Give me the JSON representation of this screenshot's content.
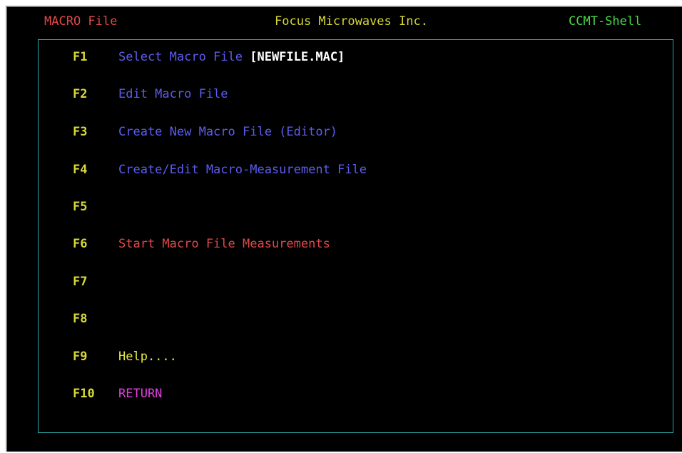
{
  "header": {
    "left": "MACRO File",
    "center": "Focus Microwaves Inc.",
    "right": "CCMT-Shell"
  },
  "menu": [
    {
      "key": "F1",
      "label": "Select Macro File ",
      "suffix": "[NEWFILE.MAC]",
      "color": "#5c5cf0"
    },
    {
      "key": "F2",
      "label": "Edit Macro File",
      "suffix": "",
      "color": "#5c5cf0"
    },
    {
      "key": "F3",
      "label": "Create New Macro File (Editor)",
      "suffix": "",
      "color": "#5c5cf0"
    },
    {
      "key": "F4",
      "label": "Create/Edit Macro-Measurement File",
      "suffix": "",
      "color": "#5c5cf0"
    },
    {
      "key": "F5",
      "label": "",
      "suffix": "",
      "color": "#5c5cf0"
    },
    {
      "key": "F6",
      "label": "Start Macro File Measurements",
      "suffix": "",
      "color": "#e04848"
    },
    {
      "key": "F7",
      "label": "",
      "suffix": "",
      "color": "#5c5cf0"
    },
    {
      "key": "F8",
      "label": "",
      "suffix": "",
      "color": "#5c5cf0"
    },
    {
      "key": "F9",
      "label": "Help....",
      "suffix": "",
      "color": "#e8e840"
    },
    {
      "key": "F10",
      "label": "RETURN",
      "suffix": "",
      "color": "#e040e0"
    }
  ]
}
